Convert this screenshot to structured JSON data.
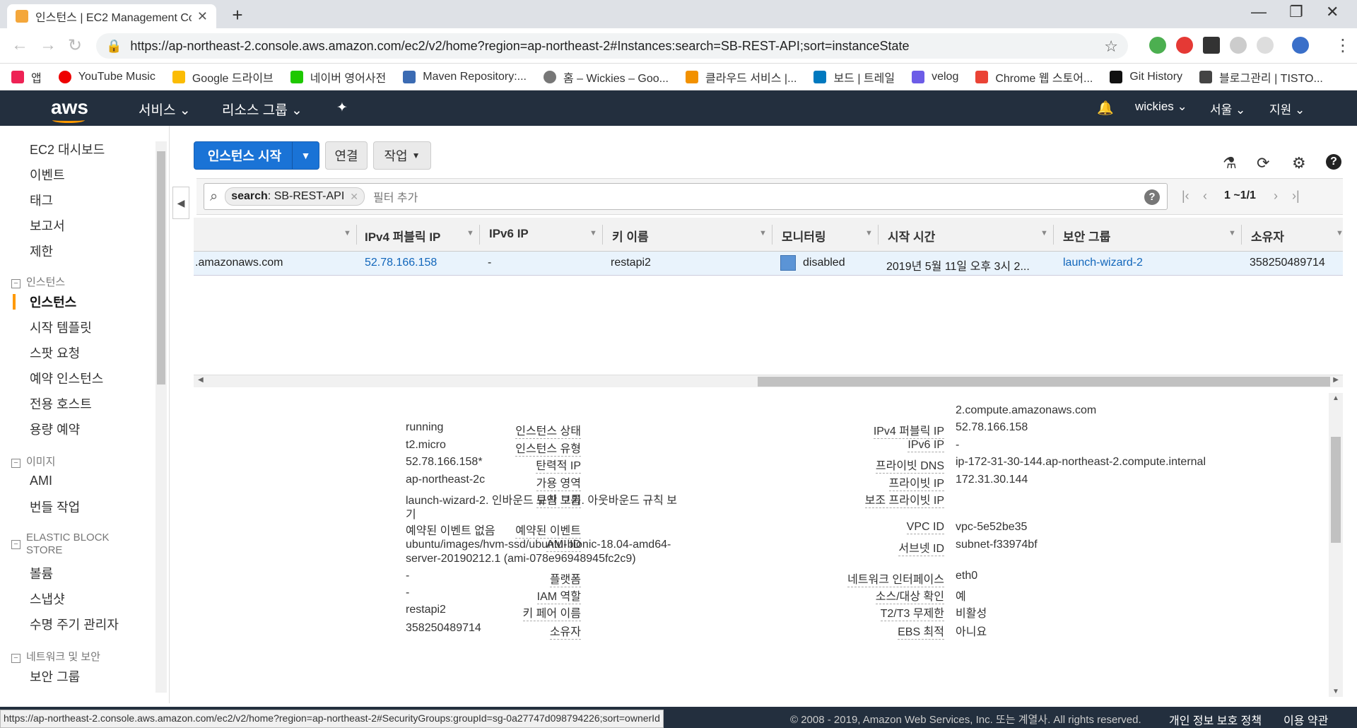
{
  "browser": {
    "tab_title": "인스턴스 | EC2 Management Co",
    "url": "https://ap-northeast-2.console.aws.amazon.com/ec2/v2/home?region=ap-northeast-2#Instances:search=SB-REST-API;sort=instanceState",
    "bookmarks": [
      "앱",
      "YouTube Music",
      "Google 드라이브",
      "네이버 영어사전",
      "Maven Repository:...",
      "홈 – Wickies – Goo...",
      "클라우드 서비스 |...",
      "보드 | 트레일",
      "velog",
      "Chrome 웹 스토어...",
      "Git History",
      "블로그관리 | TISTO..."
    ],
    "status_url": "https://ap-northeast-2.console.aws.amazon.com/ec2/v2/home?region=ap-northeast-2#SecurityGroups:groupId=sg-0a27747d098794226;sort=ownerId"
  },
  "aws_nav": {
    "logo": "aws",
    "services": "서비스",
    "resource_groups": "리소스 그룹",
    "user": "wickies",
    "region": "서울",
    "support": "지원"
  },
  "sidebar": {
    "top_items": [
      "EC2 대시보드",
      "이벤트",
      "태그",
      "보고서",
      "제한"
    ],
    "group_instances": "인스턴스",
    "instances_items": [
      "인스턴스",
      "시작 템플릿",
      "스팟 요청",
      "예약 인스턴스",
      "전용 호스트",
      "용량 예약"
    ],
    "group_images": "이미지",
    "images_items": [
      "AMI",
      "번들 작업"
    ],
    "group_ebs": "ELASTIC BLOCK STORE",
    "ebs_items": [
      "볼륨",
      "스냅샷",
      "수명 주기 관리자"
    ],
    "group_network": "네트워크 및 보안",
    "network_items": [
      "보안 그룹"
    ]
  },
  "toolbar": {
    "launch": "인스턴스 시작",
    "connect": "연결",
    "actions": "작업"
  },
  "filter": {
    "chip_key": "search",
    "chip_value": " : SB-REST-API",
    "placeholder": "필터 추가",
    "pager": "1 ~1/1"
  },
  "table": {
    "headers": [
      "IPv4 퍼블릭 IP",
      "IPv6 IP",
      "키 이름",
      "모니터링",
      "시작 시간",
      "보안 그룹",
      "소유자"
    ],
    "row": {
      "dns_suffix": ".amazonaws.com",
      "ipv4": "52.78.166.158",
      "ipv6": "-",
      "key": "restapi2",
      "monitoring": "disabled",
      "launch_time": "2019년 5월 11일 오후 3시 2...",
      "security_group": "launch-wizard-2",
      "owner": "358250489714"
    }
  },
  "details": {
    "left": [
      {
        "label": "인스턴스 상태",
        "value": "running"
      },
      {
        "label": "인스턴스 유형",
        "value": "t2.micro"
      },
      {
        "label": "탄력적 IP",
        "value": "52.78.166.158*"
      },
      {
        "label": "가용 영역",
        "value": "ap-northeast-2c"
      },
      {
        "label": "보안 그룹",
        "value": "launch-wizard-2. 인바운드 규칙 보기. 아웃바운드 규칙 보",
        "value2": "기"
      },
      {
        "label": "예약된 이벤트",
        "value": "예약된 이벤트 없음"
      },
      {
        "label": "AMI ID",
        "value": "ubuntu/images/hvm-ssd/ubuntu-bionic-18.04-amd64-",
        "value2": "server-20190212.1 (ami-078e96948945fc2c9)"
      },
      {
        "label": "플랫폼",
        "value": "-"
      },
      {
        "label": "IAM 역할",
        "value": "-"
      },
      {
        "label": "키 페어 이름",
        "value": "restapi2"
      },
      {
        "label": "소유자",
        "value": "358250489714"
      }
    ],
    "right": [
      {
        "label": "",
        "value": "2.compute.amazonaws.com"
      },
      {
        "label": "IPv4 퍼블릭 IP",
        "value": "52.78.166.158"
      },
      {
        "label": "IPv6 IP",
        "value": "-"
      },
      {
        "label": "프라이빗 DNS",
        "value": "ip-172-31-30-144.ap-northeast-2.compute.internal"
      },
      {
        "label": "프라이빗 IP",
        "value": "172.31.30.144"
      },
      {
        "label": "보조 프라이빗 IP",
        "value": ""
      },
      {
        "label": "VPC ID",
        "value": "vpc-5e52be35"
      },
      {
        "label": "서브넷 ID",
        "value": "subnet-f33974bf"
      },
      {
        "label": "네트워크 인터페이스",
        "value": "eth0"
      },
      {
        "label": "소스/대상 확인",
        "value": "예"
      },
      {
        "label": "T2/T3 무제한",
        "value": "비활성"
      },
      {
        "label": "EBS 최적",
        "value": "아니요"
      }
    ]
  },
  "footer": {
    "copyright": "© 2008 - 2019, Amazon Web Services, Inc. 또는 계열사. All rights reserved.",
    "privacy": "개인 정보 보호 정책",
    "terms": "이용 약관"
  }
}
